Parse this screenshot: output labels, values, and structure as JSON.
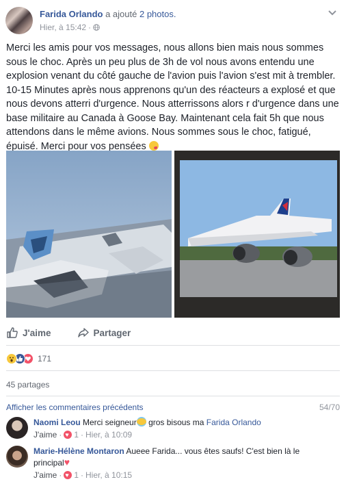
{
  "post": {
    "author": "Farida Orlando",
    "action_text": "a ajouté",
    "photos_text": "2 photos.",
    "timestamp": "Hier, à 15:42",
    "meta_separator": "·",
    "text": "Merci les amis pour vos messages, nous allons bien mais nous sommes sous le choc. Après un peu plus de 3h de vol nous avons entendu une explosion venant du côté gauche de l'avion puis l'avion s'est mit à trembler. 10-15 Minutes après nous apprenons qu'un des réacteurs a explosé et que nous devons atterri d'urgence. Nous atterrissons alors r d'urgence dans une base militaire au Canada à Goose Bay. Maintenant cela fait 5h que nous attendons dans le même avions. Nous sommes sous le choc, fatigué, épuisé. Merci pour vos pensées",
    "photos": [
      {
        "subject": "damaged-engine-photo"
      },
      {
        "subject": "airplane-on-tarmac-photo"
      }
    ]
  },
  "actions": {
    "like_label": "J'aime",
    "share_label": "Partager"
  },
  "reactions": {
    "types": [
      "wow",
      "like",
      "love"
    ],
    "count": "171"
  },
  "shares": "45 partages",
  "comments_section": {
    "view_previous": "Afficher les commentaires précédents",
    "count": "54/70"
  },
  "comments": [
    {
      "name": "Naomi Leou",
      "text": "Merci seigneur",
      "text_after": "gros bisous ma",
      "mention": "Farida Orlando",
      "like_label": "J'aime",
      "reaction_count": "1",
      "time": "Hier, à 10:09"
    },
    {
      "name": "Marie-Hélène Montaron",
      "text": "Aueee Farida... vous êtes saufs! C'est bien là le principal",
      "like_label": "J'aime",
      "reaction_count": "1",
      "time": "Hier, à 10:15"
    }
  ],
  "colors": {
    "link": "#365899",
    "muted": "#90949c",
    "text": "#1d2129",
    "love": "#f25268",
    "like": "#3b5998"
  }
}
